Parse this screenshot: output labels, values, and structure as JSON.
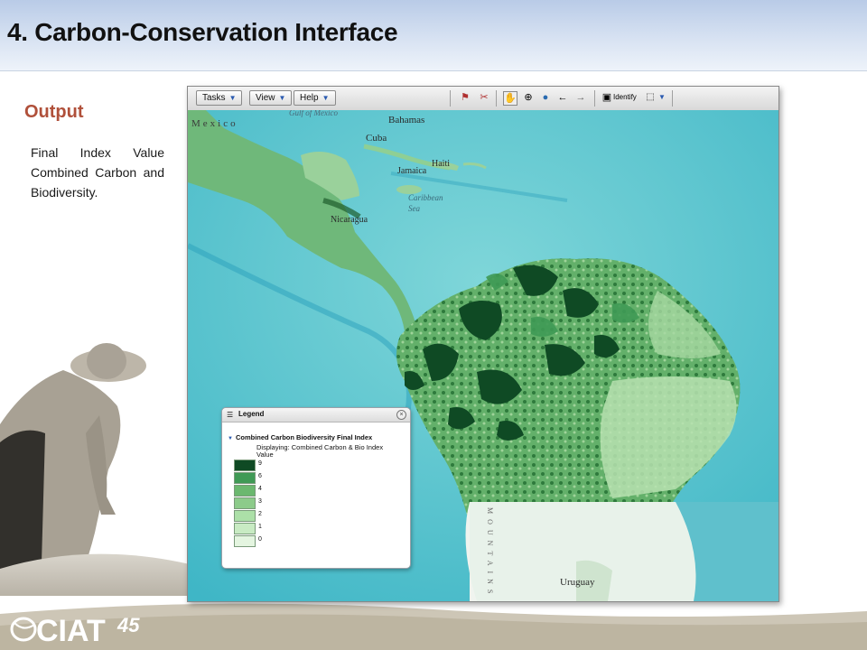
{
  "slide": {
    "title": "4. Carbon-Conservation Interface",
    "output_heading": "Output",
    "description": "Final Index Value Combined Carbon and Biodiversity."
  },
  "toolbar": {
    "tasks_label": "Tasks",
    "view_label": "View",
    "help_label": "Help",
    "identify_label": "Identify"
  },
  "map": {
    "place_labels": [
      "Mexico",
      "Gulf of Mexico",
      "Bahamas",
      "Cuba",
      "Jamaica",
      "Haiti",
      "Caribbean",
      "Sea",
      "Nicaragua",
      "Uruguay",
      "MOUNTAINS"
    ]
  },
  "legend": {
    "title": "Legend",
    "layer_name": "Combined Carbon Biodiversity Final Index",
    "displaying": "Displaying:  Combined Carbon & Bio Index Value",
    "items": [
      {
        "label": "9",
        "color": "#0f4a24"
      },
      {
        "label": "6",
        "color": "#3f9a55"
      },
      {
        "label": "4",
        "color": "#6bb86f"
      },
      {
        "label": "3",
        "color": "#8ccb8a"
      },
      {
        "label": "2",
        "color": "#ace0a8"
      },
      {
        "label": "1",
        "color": "#c8ebc3"
      },
      {
        "label": "0",
        "color": "#e4f5e0"
      }
    ]
  },
  "colors": {
    "accent": "#b0503a",
    "ocean": "#55c4cf"
  }
}
